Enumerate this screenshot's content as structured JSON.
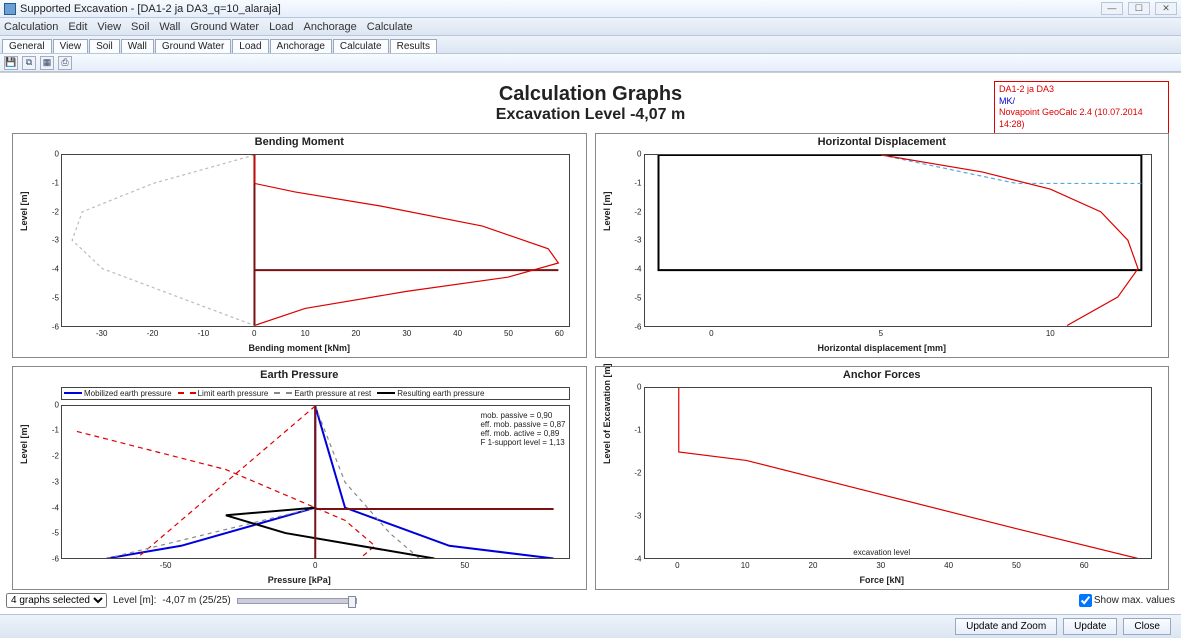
{
  "window": {
    "title": "Supported Excavation - [DA1-2 ja DA3_q=10_alaraja]",
    "winbtns": [
      "—",
      "☐",
      "✕"
    ]
  },
  "menubar": [
    "Calculation",
    "Edit",
    "View",
    "Soil",
    "Wall",
    "Ground Water",
    "Load",
    "Anchorage",
    "Calculate"
  ],
  "tabs": [
    "General",
    "View",
    "Soil",
    "Wall",
    "Ground Water",
    "Load",
    "Anchorage",
    "Calculate",
    "Results"
  ],
  "active_tab_index": 8,
  "toolbar_icons": [
    "save-icon",
    "copy-icon",
    "table-icon",
    "print-icon"
  ],
  "page": {
    "title": "Calculation Graphs",
    "subtitle": "Excavation Level -4,07 m"
  },
  "infobox": {
    "line1": "DA1-2 ja DA3",
    "line2": "MK/",
    "line3": "Novapoint GeoCalc 2.4 (10.07.2014 14:28)"
  },
  "bottom": {
    "selector": "4 graphs selected",
    "level_label": "Level [m]:",
    "level_value": "-4,07 m (25/25)",
    "showmax": "Show max. values",
    "showmax_checked": true
  },
  "footer": {
    "btn1": "Update and Zoom",
    "btn2": "Update",
    "btn3": "Close"
  },
  "chart_data": [
    {
      "id": "bending",
      "title": "Bending Moment",
      "xlabel": "Bending moment [kNm]",
      "ylabel": "Level [m]",
      "xlim": [
        -38,
        62
      ],
      "ylim": [
        -6,
        0
      ],
      "xticks": [
        -30,
        -20,
        -10,
        0,
        10,
        20,
        30,
        40,
        50,
        60
      ],
      "yticks": [
        0,
        -1,
        -2,
        -3,
        -4,
        -5,
        -6
      ],
      "type": "line",
      "series": [
        {
          "name": "bm-grey-dash",
          "stroke": "#bbb",
          "dash": "3,3",
          "points": [
            [
              0,
              0
            ],
            [
              -20,
              -1
            ],
            [
              -34,
              -2
            ],
            [
              -36,
              -3
            ],
            [
              -30,
              -4
            ],
            [
              -15,
              -5
            ],
            [
              0,
              -6
            ]
          ]
        },
        {
          "name": "bm-darkred-step",
          "stroke": "#7a1212",
          "width": 2,
          "points": [
            [
              0,
              0
            ],
            [
              0,
              -1
            ],
            [
              0,
              -4.05
            ],
            [
              60,
              -4.05
            ],
            [
              0,
              -4.05
            ],
            [
              0,
              -6
            ]
          ]
        },
        {
          "name": "bm-red-curve",
          "stroke": "#d00",
          "points": [
            [
              0,
              0
            ],
            [
              0,
              -1
            ],
            [
              8,
              -1.3
            ],
            [
              25,
              -1.8
            ],
            [
              45,
              -2.5
            ],
            [
              58,
              -3.3
            ],
            [
              60,
              -3.8
            ],
            [
              50,
              -4.3
            ],
            [
              30,
              -4.8
            ],
            [
              10,
              -5.4
            ],
            [
              0,
              -6
            ]
          ]
        }
      ]
    },
    {
      "id": "hdisp",
      "title": "Horizontal Displacement",
      "xlabel": "Horizontal displacement [mm]",
      "ylabel": "Level [m]",
      "xlim": [
        -2,
        13
      ],
      "ylim": [
        -6,
        0
      ],
      "xticks": [
        0,
        5,
        10
      ],
      "yticks": [
        0,
        -1,
        -2,
        -3,
        -4,
        -5,
        -6
      ],
      "type": "line",
      "series": [
        {
          "name": "hd-black-box",
          "stroke": "#000",
          "width": 2,
          "points": [
            [
              -1.6,
              0
            ],
            [
              -1.6,
              -4.05
            ],
            [
              12.7,
              -4.05
            ],
            [
              12.7,
              0
            ],
            [
              -1.6,
              0
            ]
          ]
        },
        {
          "name": "hd-blue-dash",
          "stroke": "#5ad",
          "dash": "4,3",
          "points": [
            [
              5,
              0
            ],
            [
              9,
              -1
            ],
            [
              12.7,
              -1
            ]
          ]
        },
        {
          "name": "hd-red",
          "stroke": "#d00",
          "points": [
            [
              5,
              0
            ],
            [
              8,
              -0.6
            ],
            [
              10,
              -1.2
            ],
            [
              11.5,
              -2
            ],
            [
              12.3,
              -3
            ],
            [
              12.6,
              -4
            ],
            [
              12.0,
              -5
            ],
            [
              10.5,
              -6
            ]
          ]
        }
      ]
    },
    {
      "id": "earthp",
      "title": "Earth Pressure",
      "xlabel": "Pressure [kPa]",
      "ylabel": "Level [m]",
      "xlim": [
        -85,
        85
      ],
      "ylim": [
        -6,
        0
      ],
      "xticks": [
        -50,
        0,
        50
      ],
      "yticks": [
        0,
        -1,
        -2,
        -3,
        -4,
        -5,
        -6
      ],
      "type": "line",
      "legend": [
        {
          "sw": "#00d",
          "label": "Mobilized earth pressure"
        },
        {
          "sw": "#d00",
          "dash": true,
          "label": "Limit earth pressure"
        },
        {
          "sw": "#888",
          "dash": true,
          "label": "Earth pressure at rest"
        },
        {
          "sw": "#000",
          "label": "Resulting earth pressure"
        }
      ],
      "annot": [
        "mob. passive = 0,90",
        "eff. mob. passive = 0,87",
        "eff. mob. active = 0,89",
        "F 1-support level = 1,13"
      ],
      "series": [
        {
          "name": "ep-blue",
          "stroke": "#00d",
          "width": 2,
          "points": [
            [
              0,
              0
            ],
            [
              0,
              -4
            ],
            [
              -45,
              -5.5
            ],
            [
              -70,
              -6
            ]
          ]
        },
        {
          "name": "ep-blue-r",
          "stroke": "#00d",
          "width": 2,
          "points": [
            [
              0,
              0
            ],
            [
              5,
              -2
            ],
            [
              10,
              -4
            ],
            [
              45,
              -5.5
            ],
            [
              80,
              -6
            ]
          ]
        },
        {
          "name": "ep-red-dash",
          "stroke": "#d00",
          "dash": "5,4",
          "points": [
            [
              -80,
              -1
            ],
            [
              -30,
              -2.5
            ],
            [
              0,
              -4
            ],
            [
              10,
              -4.5
            ],
            [
              20,
              -5.5
            ],
            [
              15,
              -6
            ]
          ]
        },
        {
          "name": "ep-red-dash-r",
          "stroke": "#d00",
          "dash": "5,4",
          "points": [
            [
              0,
              0
            ],
            [
              -60,
              -6
            ]
          ]
        },
        {
          "name": "ep-grey-dash",
          "stroke": "#888",
          "dash": "4,4",
          "points": [
            [
              -70,
              -6
            ],
            [
              0,
              -4
            ],
            [
              0,
              0
            ]
          ]
        },
        {
          "name": "ep-grey-dash-r",
          "stroke": "#888",
          "dash": "4,4",
          "points": [
            [
              0,
              0
            ],
            [
              10,
              -3
            ],
            [
              25,
              -5
            ],
            [
              35,
              -6
            ]
          ]
        },
        {
          "name": "ep-black",
          "stroke": "#000",
          "width": 2,
          "points": [
            [
              0,
              -4
            ],
            [
              -30,
              -4.3
            ],
            [
              -10,
              -5
            ],
            [
              40,
              -6
            ]
          ]
        },
        {
          "name": "ep-darkred-step",
          "stroke": "#7a1212",
          "width": 2,
          "points": [
            [
              0,
              0
            ],
            [
              0,
              -4.05
            ],
            [
              80,
              -4.05
            ],
            [
              0,
              -4.05
            ],
            [
              0,
              -6
            ]
          ]
        }
      ]
    },
    {
      "id": "anchor",
      "title": "Anchor Forces",
      "xlabel": "Force [kN]",
      "ylabel": "Level of Excavation [m]",
      "xlim": [
        -5,
        70
      ],
      "ylim": [
        -4,
        0
      ],
      "xticks": [
        0,
        10,
        20,
        30,
        40,
        50,
        60
      ],
      "yticks": [
        0,
        -1,
        -2,
        -3,
        -4
      ],
      "type": "line",
      "note": "excavation level",
      "series": [
        {
          "name": "af-red",
          "stroke": "#d00",
          "points": [
            [
              0,
              0
            ],
            [
              0,
              -1.5
            ],
            [
              10,
              -1.7
            ],
            [
              30,
              -2.5
            ],
            [
              50,
              -3.3
            ],
            [
              68,
              -4
            ]
          ]
        }
      ]
    }
  ]
}
